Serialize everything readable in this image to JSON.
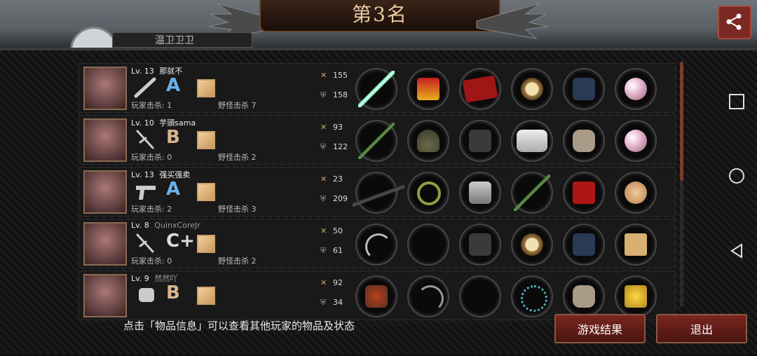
{
  "header": {
    "rank_title": "第3名",
    "peek_name": "温卫卫卫"
  },
  "rows": [
    {
      "level": "Lv. 13",
      "name": "那就不",
      "name_dim": false,
      "weapon": "bat-icon",
      "grade": "A",
      "player_kills_label": "玩家击杀: 1",
      "monster_kills_label": "野怪击杀 7",
      "atk": "155",
      "def": "158",
      "items": [
        "sword",
        "crown",
        "cape",
        "watch",
        "boots",
        "pearl"
      ]
    },
    {
      "level": "Lv. 10",
      "name": "芋頭sama",
      "name_dim": false,
      "weapon": "sai-icon",
      "grade": "B",
      "player_kills_label": "玩家击杀: 0",
      "monster_kills_label": "野怪击杀 2",
      "atk": "93",
      "def": "122",
      "items": [
        "stick",
        "helmet",
        "jacket",
        "bandage",
        "shoes",
        "pearl"
      ]
    },
    {
      "level": "Lv. 13",
      "name": "强买强卖",
      "name_dim": false,
      "weapon": "pistol-icon",
      "grade": "A",
      "player_kills_label": "玩家击杀: 2",
      "monster_kills_label": "野怪击杀 3",
      "atk": "23",
      "def": "209",
      "items": [
        "rifle",
        "laurel",
        "armor",
        "stick",
        "redheels",
        "lollipop"
      ]
    },
    {
      "level": "Lv. 8",
      "name": "QuinxCoreJr",
      "name_dim": true,
      "weapon": "sai-icon",
      "grade": "C+",
      "player_kills_label": "玩家击杀: 0",
      "monster_kills_label": "野怪击杀 2",
      "atk": "50",
      "def": "61",
      "items": [
        "scythe",
        "empty",
        "jacket",
        "watch",
        "boots",
        "box"
      ]
    },
    {
      "level": "Lv. 9",
      "name": "然然吖",
      "name_dim": true,
      "weapon": "fist-icon",
      "grade": "B",
      "player_kills_label": "",
      "monster_kills_label": "",
      "atk": "92",
      "def": "34",
      "items": [
        "gauntlet",
        "ring",
        "empty",
        "beads",
        "shoes",
        "bow"
      ]
    }
  ],
  "footer": {
    "hint": "点击「物品信息」可以查看其他玩家的物品及状态",
    "result_button": "游戏结果",
    "exit_button": "退出"
  }
}
